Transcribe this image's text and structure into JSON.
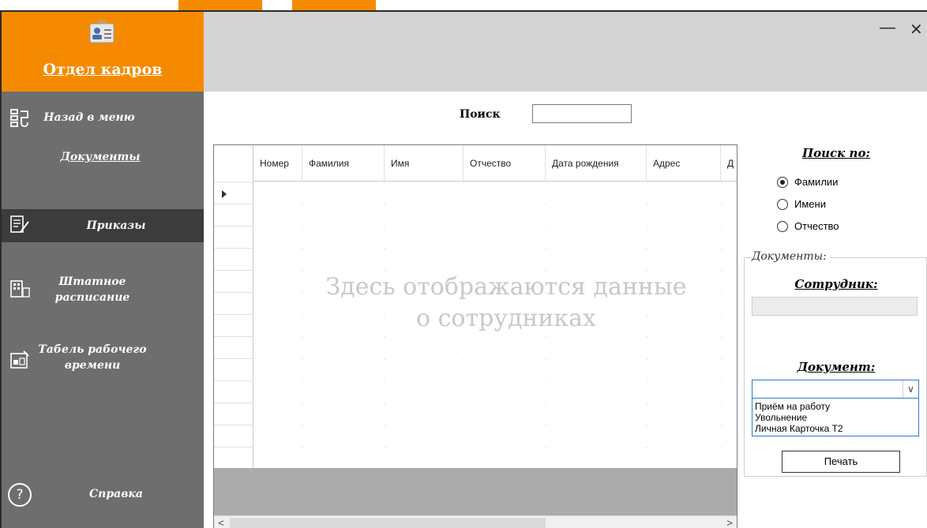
{
  "app": {
    "title": "Отдел кадров"
  },
  "sidebar": {
    "back": "Назад в меню",
    "documents": "Документы",
    "items": [
      {
        "label": "Приказы",
        "icon": "orders-icon",
        "active": true
      },
      {
        "label": "Штатное расписание",
        "icon": "staffing-icon",
        "active": false
      },
      {
        "label": "Табель рабочего времени",
        "icon": "timesheet-icon",
        "active": false
      }
    ],
    "help": "Справка"
  },
  "window_controls": {
    "minimize": "—",
    "close": "✕"
  },
  "search": {
    "label": "Поиск",
    "value": ""
  },
  "grid": {
    "columns": [
      "Номер",
      "Фамилия",
      "Имя",
      "Отчество",
      "Дата рождения",
      "Адрес",
      "Д"
    ],
    "placeholder_line1": "Здесь отображаются данные",
    "placeholder_line2": "о сотрудниках",
    "scroll_left": "<",
    "scroll_right": ">"
  },
  "search_by": {
    "title": "Поиск по:",
    "options": [
      {
        "label": "Фамилии",
        "selected": true
      },
      {
        "label": "Имени",
        "selected": false
      },
      {
        "label": "Отчество",
        "selected": false
      }
    ]
  },
  "documents_panel": {
    "legend": "Документы:",
    "employee_title": "Сотрудник:",
    "employee_value": "",
    "document_title": "Документ:",
    "document_value": "",
    "options": [
      "Приём на работу",
      "Увольнение",
      "Личная Карточка Т2"
    ],
    "print_label": "Печать"
  },
  "colors": {
    "accent": "#f58a00",
    "sidebar": "#6e6e6e",
    "sidebar_active": "#3c3c3c",
    "header": "#d4d4d4"
  }
}
